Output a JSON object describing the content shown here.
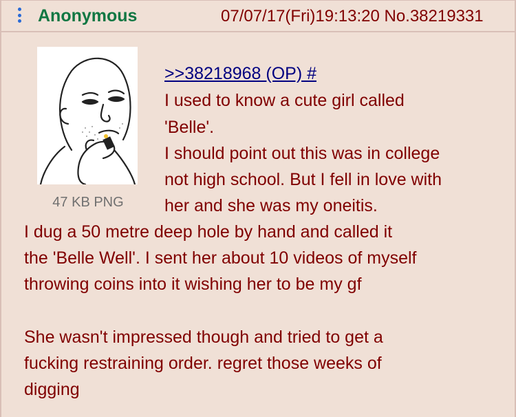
{
  "header": {
    "name": "Anonymous",
    "date": "07/07/17(Fri)19:13:20",
    "post_number": "No.38219331"
  },
  "file": {
    "size_label": "47 KB PNG"
  },
  "body": {
    "quotelink": ">>38218968 (OP) #",
    "lines": [
      "I used to know a cute girl called",
      "'Belle'.",
      "I should point out this was in college",
      "not high school. But I fell in love with",
      "her and she was my oneitis.",
      "I dug a 50 metre deep hole by hand and called it",
      "the 'Belle Well'. I sent her about 10 videos of myself",
      "throwing coins into it wishing her to be my gf",
      "She wasn't impressed though and tried to get a",
      "fucking restraining order. regret those weeks of",
      "digging"
    ]
  },
  "colors": {
    "background": "#f0e0d6",
    "name": "#117743",
    "text": "#800000",
    "link": "#000080",
    "menu_icon": "#2a6ad6"
  }
}
